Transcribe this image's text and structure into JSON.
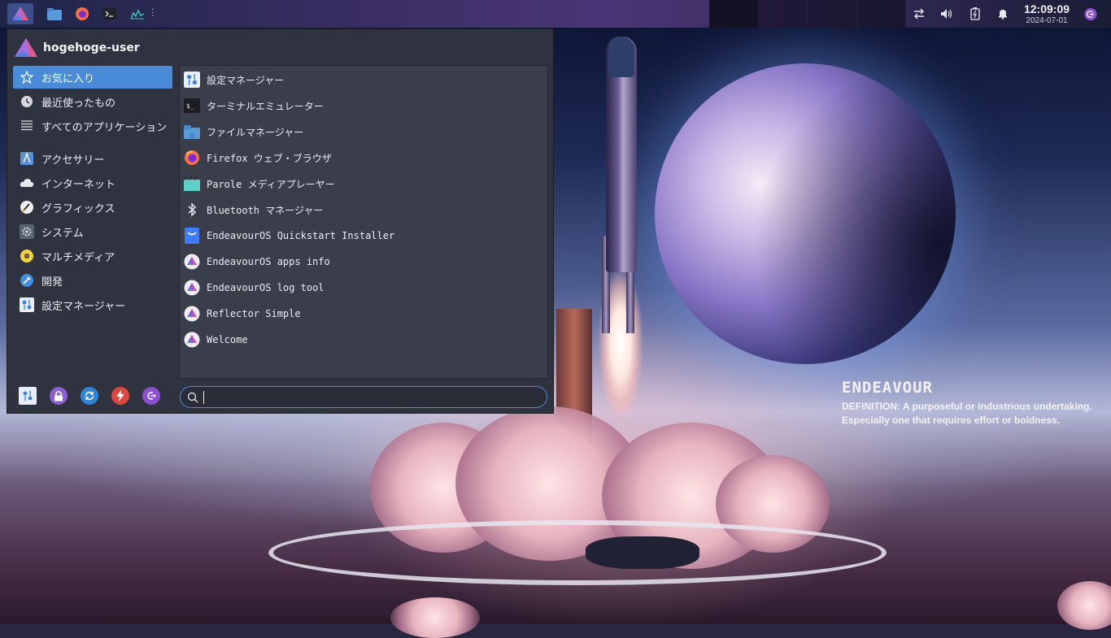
{
  "panel": {
    "clock_time": "12:09:09",
    "clock_date": "2024-07-01",
    "launchers": [
      "file-manager-icon",
      "firefox-icon",
      "terminal-icon",
      "system-monitor-icon"
    ],
    "tray": [
      "network-icon",
      "volume-icon",
      "battery-icon",
      "notification-bell-icon",
      "logout-icon"
    ]
  },
  "menu": {
    "user_name": "hogehoge-user",
    "categories": [
      {
        "label": "お気に入り",
        "icon": "star-icon",
        "selected": true
      },
      {
        "label": "最近使ったもの",
        "icon": "clock-icon"
      },
      {
        "label": "すべてのアプリケーション",
        "icon": "list-icon"
      },
      {
        "label": "アクセサリー",
        "icon": "accessories-icon"
      },
      {
        "label": "インターネット",
        "icon": "cloud-icon"
      },
      {
        "label": "グラフィックス",
        "icon": "graphics-icon"
      },
      {
        "label": "システム",
        "icon": "system-gear-icon"
      },
      {
        "label": "マルチメディア",
        "icon": "multimedia-icon"
      },
      {
        "label": "開発",
        "icon": "development-icon"
      },
      {
        "label": "設定マネージャー",
        "icon": "settings-icon"
      }
    ],
    "apps": [
      {
        "label": "設定マネージャー",
        "icon": "settings-icon"
      },
      {
        "label": "ターミナルエミュレーター",
        "icon": "terminal-icon"
      },
      {
        "label": "ファイルマネージャー",
        "icon": "folder-icon"
      },
      {
        "label": "Firefox ウェブ・ブラウザ",
        "icon": "firefox-icon"
      },
      {
        "label": "Parole メディアプレーヤー",
        "icon": "parole-icon"
      },
      {
        "label": "Bluetooth マネージャー",
        "icon": "bluetooth-icon"
      },
      {
        "label": "EndeavourOS Quickstart Installer",
        "icon": "quickstart-icon"
      },
      {
        "label": "EndeavourOS apps info",
        "icon": "endeavouros-icon"
      },
      {
        "label": "EndeavourOS log tool",
        "icon": "endeavouros-icon"
      },
      {
        "label": "Reflector Simple",
        "icon": "endeavouros-icon"
      },
      {
        "label": "Welcome",
        "icon": "endeavouros-icon"
      }
    ],
    "actions": [
      "settings-icon",
      "lock-icon",
      "switch-user-icon",
      "power-icon",
      "logout-icon"
    ],
    "search": {
      "value": "",
      "placeholder": ""
    }
  },
  "wallpaper": {
    "title": "ENDEAVOUR",
    "definition_line1": "DEFINITION: A purposeful or industrious undertaking.",
    "definition_line2": "Especially one that requires effort or boldness."
  },
  "colors": {
    "accent": "#4a8bd9",
    "menu_bg": "#2f3340",
    "app_pane_bg": "#3a3e4b",
    "endeavour_purple": "#7f3fbf"
  }
}
